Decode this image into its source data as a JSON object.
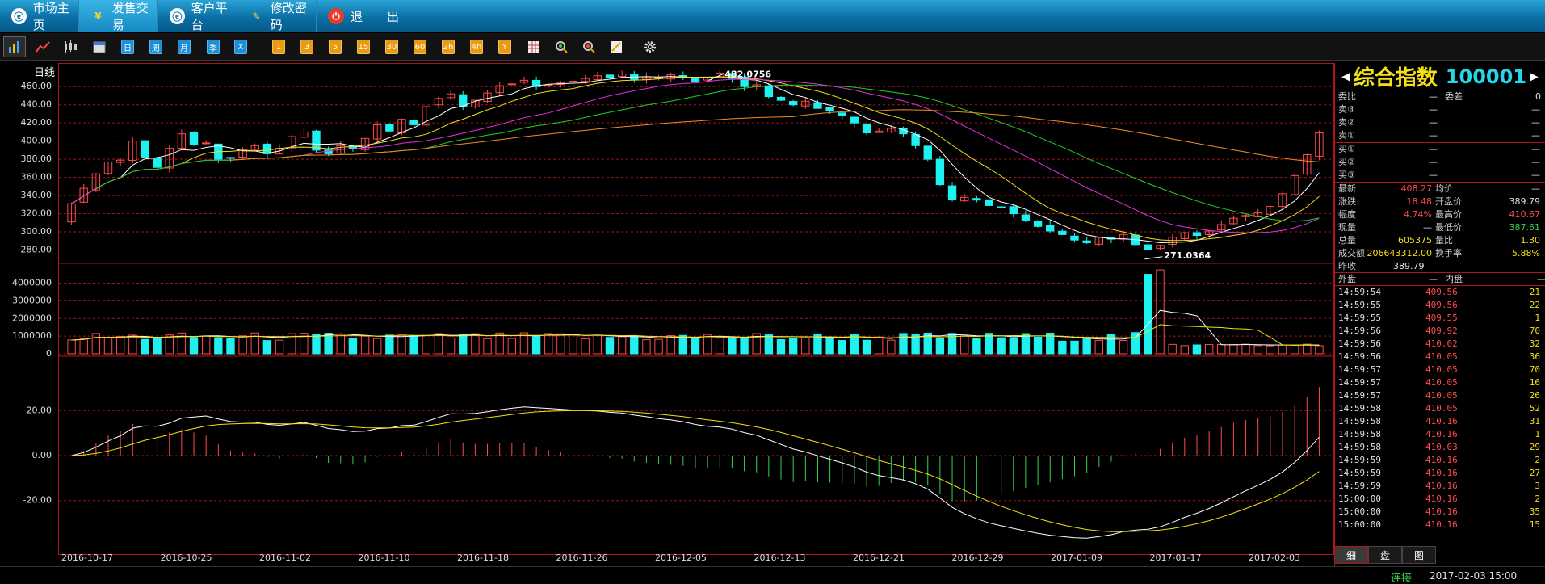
{
  "nav": {
    "tabs": [
      {
        "label": "市场主页",
        "icon": "home-icon"
      },
      {
        "label": "发售交易",
        "icon": "yen-icon"
      },
      {
        "label": "客户平台",
        "icon": "platform-icon"
      },
      {
        "label": "修改密码",
        "icon": "key-icon"
      },
      {
        "label": "退　　出",
        "icon": "power-icon"
      }
    ]
  },
  "toolbar": {
    "periods": [
      "日",
      "周",
      "月",
      "季",
      "X"
    ],
    "minutes": [
      "1",
      "3",
      "5",
      "15",
      "30",
      "60",
      "2h",
      "4h",
      "Y"
    ]
  },
  "chart": {
    "period_label": "日线",
    "high_label": "482.0756",
    "low_label": "271.0364",
    "price_ticks": [
      "460.00",
      "440.00",
      "420.00",
      "400.00",
      "380.00",
      "360.00",
      "340.00",
      "320.00",
      "300.00",
      "280.00"
    ],
    "volume_ticks": [
      "4000000",
      "3000000",
      "2000000",
      "1000000",
      "0"
    ],
    "macd_ticks": [
      "20.00",
      "0.00",
      "-20.00"
    ],
    "date_ticks": [
      "2016-10-17",
      "2016-10-25",
      "2016-11-02",
      "2016-11-10",
      "2016-11-18",
      "2016-11-26",
      "2016-12-05",
      "2016-12-13",
      "2016-12-21",
      "2016-12-29",
      "2017-01-09",
      "2017-01-17",
      "2017-02-03"
    ]
  },
  "chart_data": {
    "type": "candlestick",
    "price_ylim": [
      268,
      478
    ],
    "volume_ylim": [
      0,
      4800000
    ],
    "macd_ylim": [
      -42,
      42
    ],
    "closes": [
      331,
      348,
      364,
      377,
      379,
      400,
      382,
      371,
      392,
      408,
      396,
      398,
      380,
      381,
      391,
      395,
      386,
      392,
      405,
      410,
      390,
      386,
      395,
      392,
      403,
      418,
      411,
      424,
      418,
      438,
      447,
      452,
      438,
      445,
      453,
      461,
      463,
      467,
      460,
      462,
      464,
      466,
      469,
      472,
      470,
      474,
      468,
      471,
      470,
      473,
      471,
      466,
      470,
      475,
      469,
      460,
      462,
      449,
      445,
      440,
      444,
      436,
      433,
      428,
      420,
      409,
      411,
      414,
      408,
      395,
      380,
      352,
      336,
      338,
      335,
      329,
      327,
      320,
      313,
      306,
      301,
      297,
      291,
      288,
      294,
      292,
      297,
      286,
      280,
      285,
      294,
      299,
      296,
      301,
      308,
      315,
      318,
      321,
      328,
      342,
      362,
      385,
      409
    ]
  },
  "quote": {
    "name": "综合指数",
    "code": "100001",
    "weibi_label": "委比",
    "weibi_value": "—",
    "weicha_label": "委差",
    "weicha_value": "0",
    "sells": [
      {
        "label": "卖③",
        "price": "—",
        "vol": "—"
      },
      {
        "label": "卖②",
        "price": "—",
        "vol": "—"
      },
      {
        "label": "卖①",
        "price": "—",
        "vol": "—"
      }
    ],
    "buys": [
      {
        "label": "买①",
        "price": "—",
        "vol": "—"
      },
      {
        "label": "买②",
        "price": "—",
        "vol": "—"
      },
      {
        "label": "买③",
        "price": "—",
        "vol": "—"
      }
    ],
    "stats": [
      {
        "l1": "最新",
        "v1": "408.27",
        "c1": "red",
        "l2": "均价",
        "v2": "—",
        "c2": "white"
      },
      {
        "l1": "涨跌",
        "v1": "18.48",
        "c1": "red",
        "l2": "开盘价",
        "v2": "389.79",
        "c2": "white"
      },
      {
        "l1": "幅度",
        "v1": "4.74%",
        "c1": "red",
        "l2": "最高价",
        "v2": "410.67",
        "c2": "red"
      },
      {
        "l1": "现量",
        "v1": "—",
        "c1": "white",
        "l2": "最低价",
        "v2": "387.61",
        "c2": "green"
      },
      {
        "l1": "总量",
        "v1": "605375",
        "c1": "yellow",
        "l2": "量比",
        "v2": "1.30",
        "c2": "yellow"
      },
      {
        "l1": "成交额",
        "v1": "206643312.00",
        "c1": "yellow",
        "l2": "换手率",
        "v2": "5.88%",
        "c2": "yellow"
      }
    ],
    "prev_close_label": "昨收",
    "prev_close": "389.79",
    "outer_label": "外盘",
    "outer_value": "—",
    "inner_label": "内盘",
    "inner_value": "—"
  },
  "ticks": [
    {
      "time": "14:59:54",
      "price": "409.56",
      "vol": "21"
    },
    {
      "time": "14:59:55",
      "price": "409.56",
      "vol": "22"
    },
    {
      "time": "14:59:55",
      "price": "409.55",
      "vol": "1"
    },
    {
      "time": "14:59:56",
      "price": "409.92",
      "vol": "70"
    },
    {
      "time": "14:59:56",
      "price": "410.02",
      "vol": "32"
    },
    {
      "time": "14:59:56",
      "price": "410.05",
      "vol": "36"
    },
    {
      "time": "14:59:57",
      "price": "410.05",
      "vol": "70"
    },
    {
      "time": "14:59:57",
      "price": "410.05",
      "vol": "16"
    },
    {
      "time": "14:59:57",
      "price": "410.05",
      "vol": "26"
    },
    {
      "time": "14:59:58",
      "price": "410.05",
      "vol": "52"
    },
    {
      "time": "14:59:58",
      "price": "410.16",
      "vol": "31"
    },
    {
      "time": "14:59:58",
      "price": "410.16",
      "vol": "1"
    },
    {
      "time": "14:59:58",
      "price": "410.03",
      "vol": "29"
    },
    {
      "time": "14:59:59",
      "price": "410.16",
      "vol": "2"
    },
    {
      "time": "14:59:59",
      "price": "410.16",
      "vol": "27"
    },
    {
      "time": "14:59:59",
      "price": "410.16",
      "vol": "3"
    },
    {
      "time": "15:00:00",
      "price": "410.16",
      "vol": "2"
    },
    {
      "time": "15:00:00",
      "price": "410.16",
      "vol": "35"
    },
    {
      "time": "15:00:00",
      "price": "410.16",
      "vol": "15"
    }
  ],
  "bottom_tabs": [
    "细",
    "盘",
    "图"
  ],
  "status": {
    "connection": "连接",
    "datetime": "2017-02-03 15:00"
  },
  "colors": {
    "up": "#ff4a4a",
    "down": "#1ff0f0",
    "grid": "#a0141a",
    "ma5": "#ffffff",
    "ma10": "#f2e012",
    "ma20": "#e030e0",
    "ma30": "#20d020",
    "ma60": "#f08c20"
  }
}
